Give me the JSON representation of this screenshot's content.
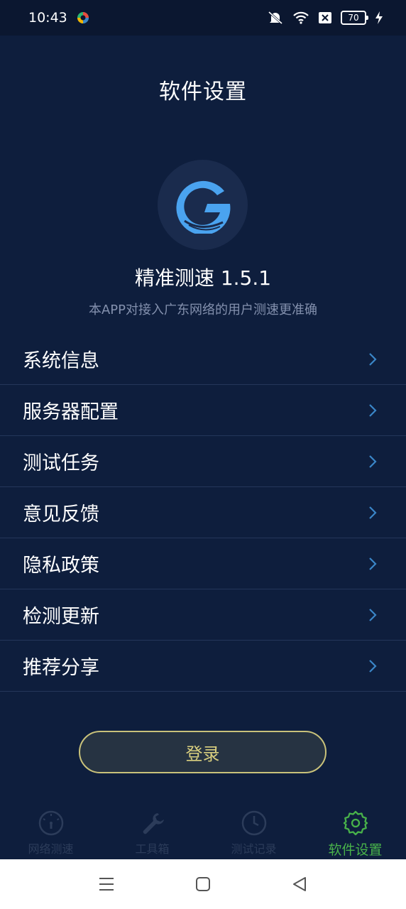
{
  "status_bar": {
    "time": "10:43",
    "battery": "70",
    "icons": [
      "app-notification-icon",
      "mute-icon",
      "wifi-icon",
      "sim-icon",
      "battery-icon",
      "charging-icon"
    ]
  },
  "header": {
    "title": "软件设置"
  },
  "app_info": {
    "logo_icon": "g-logo-icon",
    "name": "精准测速 1.5.1",
    "description": "本APP对接入广东网络的用户测速更准确"
  },
  "menu": {
    "items": [
      {
        "label": "系统信息"
      },
      {
        "label": "服务器配置"
      },
      {
        "label": "测试任务"
      },
      {
        "label": "意见反馈"
      },
      {
        "label": "隐私政策"
      },
      {
        "label": "检测更新"
      },
      {
        "label": "推荐分享"
      }
    ]
  },
  "login": {
    "label": "登录"
  },
  "tabs": [
    {
      "label": "网络测速",
      "icon": "speedometer-icon",
      "active": false
    },
    {
      "label": "工具箱",
      "icon": "wrench-icon",
      "active": false
    },
    {
      "label": "测试记录",
      "icon": "clock-icon",
      "active": false
    },
    {
      "label": "软件设置",
      "icon": "gear-icon",
      "active": true
    }
  ],
  "nav": {
    "icons": [
      "menu-icon",
      "home-icon",
      "back-icon"
    ]
  },
  "colors": {
    "background": "#0e1e3d",
    "accent_green": "#48b24a",
    "login_border": "#c9c27a",
    "chevron_blue": "#3a86c8",
    "logo_blue": "#4aa3ef"
  }
}
